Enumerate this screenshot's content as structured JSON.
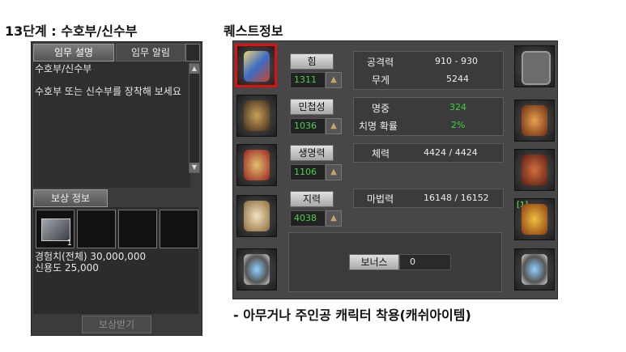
{
  "headings": {
    "step_title": "13단계 : 수호부/신수부",
    "quest_info": "퀘스트정보",
    "note": "- 아무거나 주인공 캐릭터 착용(캐쉬아이템)"
  },
  "quest_panel": {
    "tabs": [
      "임무 설명",
      "임무 알림"
    ],
    "active_tab": "임무 설명",
    "description_title": "수호부/신수부",
    "description_text": "수호부 또는 신수부를 장착해 보세요",
    "reward_tab": "보상 정보",
    "reward_item_count": "1",
    "reward_exp": "경험치(전체) 30,000,000",
    "reward_credit": "신용도 25,000",
    "claim_button": "보상받기"
  },
  "character_panel": {
    "stats": [
      {
        "label": "힘",
        "value": "1311"
      },
      {
        "label": "민첩성",
        "value": "1036"
      },
      {
        "label": "생명력",
        "value": "1106"
      },
      {
        "label": "지력",
        "value": "4038"
      }
    ],
    "info": {
      "attack_label": "공격력",
      "attack_value": "910 - 930",
      "weight_label": "무게",
      "weight_value": "5244",
      "accuracy_label": "명중",
      "accuracy_value": "324",
      "crit_label": "치명 확률",
      "crit_value": "2%",
      "hp_label": "체력",
      "hp_value": "4424 / 4424",
      "mp_label": "마법력",
      "mp_value": "16148 / 16152"
    },
    "bonus_label": "보너스",
    "bonus_value": "0",
    "slot_tag": "[1]"
  },
  "colors": {
    "highlight": "#e01010",
    "stat_value": "#4cd04c",
    "panel_bg": "#474747"
  }
}
